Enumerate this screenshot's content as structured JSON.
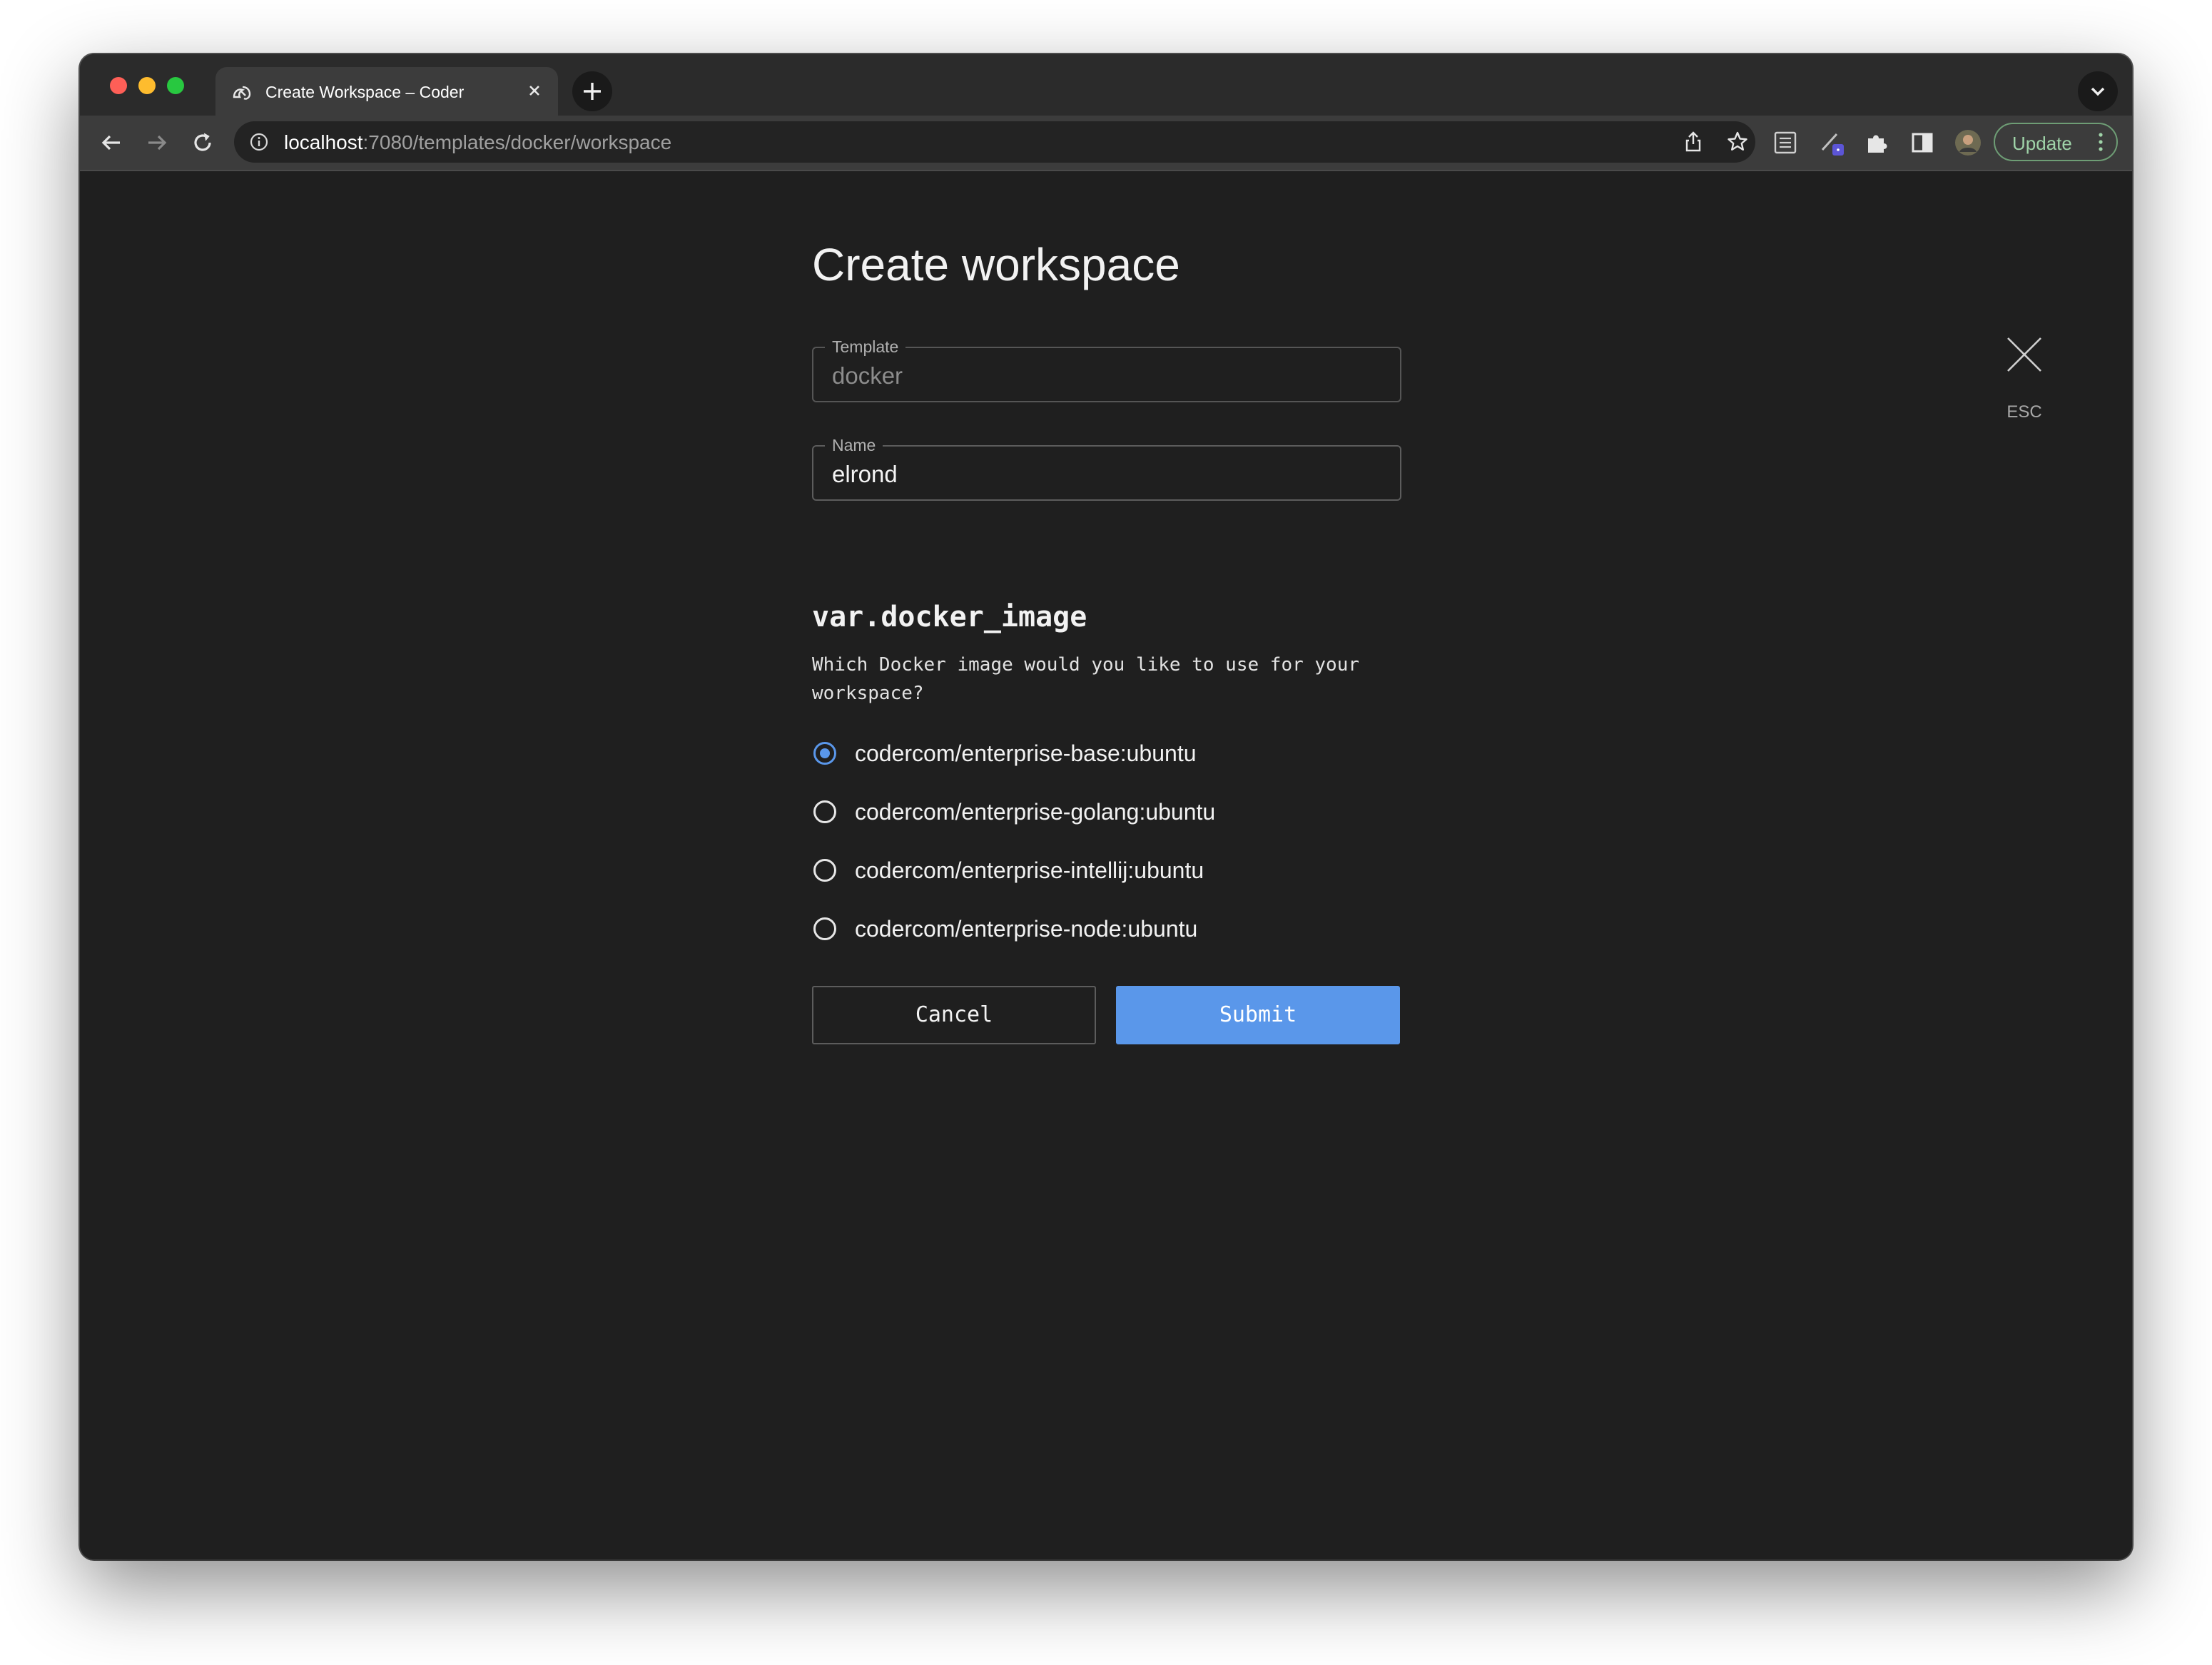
{
  "browser": {
    "tab": {
      "title": "Create Workspace – Coder",
      "close_icon": "close-icon",
      "favicon": "coder-logo-icon"
    },
    "new_tab_icon": "plus-icon",
    "tab_menu_icon": "chevron-down-icon",
    "url": {
      "host": "localhost",
      "path": ":7080/templates/docker/workspace"
    },
    "toolbar_icons": [
      "back-arrow-icon",
      "forward-arrow-icon",
      "reload-icon",
      "info-icon",
      "share-icon",
      "bookmark-star-icon",
      "reading-list-icon",
      "extension-pen-icon",
      "extensions-puzzle-icon",
      "side-panel-icon",
      "profile-avatar"
    ],
    "update_label": "Update"
  },
  "dialog": {
    "title": "Create workspace",
    "close_label": "ESC",
    "template_field": {
      "label": "Template",
      "value": "docker"
    },
    "name_field": {
      "label": "Name",
      "value": "elrond"
    },
    "parameter": {
      "name": "var.docker_image",
      "description": "Which Docker image would you like to use for your workspace?",
      "options": [
        {
          "label": "codercom/enterprise-base:ubuntu",
          "selected": true
        },
        {
          "label": "codercom/enterprise-golang:ubuntu",
          "selected": false
        },
        {
          "label": "codercom/enterprise-intellij:ubuntu",
          "selected": false
        },
        {
          "label": "codercom/enterprise-node:ubuntu",
          "selected": false
        }
      ]
    },
    "cancel_label": "Cancel",
    "submit_label": "Submit"
  },
  "colors": {
    "background": "#1f1f1f",
    "accent": "#5a97ea",
    "update_green": "#9fd3a8"
  }
}
